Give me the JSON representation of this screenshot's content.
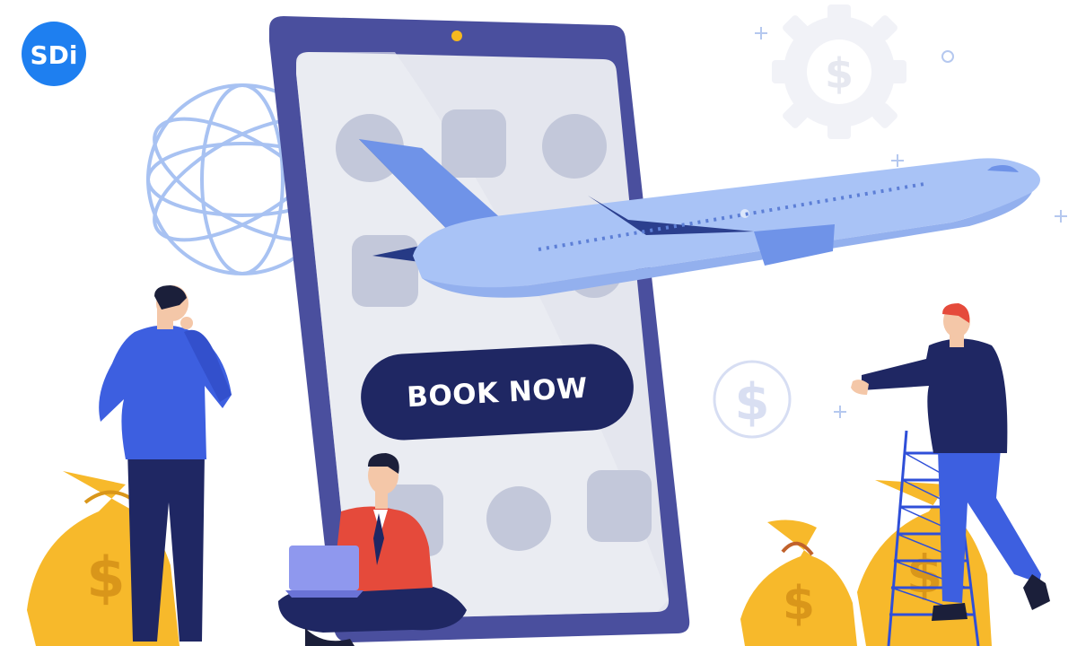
{
  "brand": {
    "logo_text": "SDi",
    "logo_color": "#1e7ff0",
    "icon": "sdi-logo-icon"
  },
  "phone": {
    "book_button_label": "BOOK NOW",
    "frame_color": "#4a4f9e",
    "screen_color": "#e4e6ee",
    "button_color": "#1f2763"
  },
  "decor": {
    "dollar_symbol": "$",
    "accent_blue": "#9db9f5",
    "money_bag_color": "#f7b92b",
    "icons": [
      "globe-icon",
      "gear-dollar-icon",
      "dollar-coin-icon",
      "airplane-icon",
      "money-bag-icon",
      "ladder-icon",
      "laptop-icon"
    ]
  }
}
